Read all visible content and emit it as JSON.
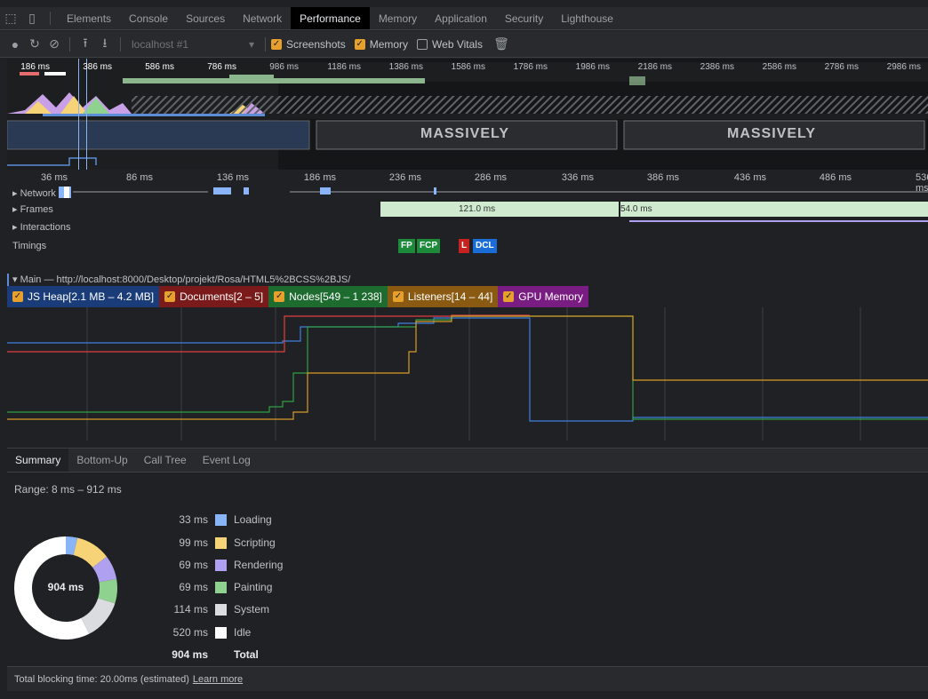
{
  "tabbar": {
    "tabs": [
      "Elements",
      "Console",
      "Sources",
      "Network",
      "Performance",
      "Memory",
      "Application",
      "Security",
      "Lighthouse"
    ],
    "active": "Performance"
  },
  "toolbar": {
    "profile_select": "localhost #1",
    "screenshots_label": "Screenshots",
    "memory_label": "Memory",
    "webvitals_label": "Web Vitals"
  },
  "overview": {
    "ticks": [
      "186 ms",
      "386 ms",
      "586 ms",
      "786 ms",
      "986 ms",
      "1186 ms",
      "1386 ms",
      "1586 ms",
      "1786 ms",
      "1986 ms",
      "2186 ms",
      "2386 ms",
      "2586 ms",
      "2786 ms",
      "2986 ms"
    ],
    "filmstrip_text": "MASSIVELY"
  },
  "timeline": {
    "ticks": [
      "36 ms",
      "86 ms",
      "136 ms",
      "186 ms",
      "236 ms",
      "286 ms",
      "336 ms",
      "386 ms",
      "436 ms",
      "486 ms",
      "536 ms"
    ]
  },
  "tracks": {
    "network": "Network",
    "frames": "Frames",
    "interactions": "Interactions",
    "timings": "Timings",
    "frame1": "121.0 ms",
    "frame2": "54.0 ms",
    "fp": "FP",
    "fcp": "FCP",
    "l": "L",
    "dcl": "DCL"
  },
  "main_track": "Main — http://localhost:8000/Desktop/projekt/Rosa/HTML5%2BCSS%2BJS/",
  "counters": [
    {
      "label": "JS Heap[2.1 MB – 4.2 MB]",
      "color": "#1a3d7a"
    },
    {
      "label": "Documents[2 – 5]",
      "color": "#7a1a1a"
    },
    {
      "label": "Nodes[549 – 1 238]",
      "color": "#1d6b2e"
    },
    {
      "label": "Listeners[14 – 44]",
      "color": "#8a5a12"
    },
    {
      "label": "GPU Memory",
      "color": "#7a1d82"
    }
  ],
  "bottom_tabs": [
    "Summary",
    "Bottom-Up",
    "Call Tree",
    "Event Log"
  ],
  "summary": {
    "range": "Range: 8 ms – 912 ms",
    "center": "904 ms",
    "rows": [
      {
        "value": "33 ms",
        "label": "Loading",
        "color": "#8ab4f8",
        "ms": 33
      },
      {
        "value": "99 ms",
        "label": "Scripting",
        "color": "#f5d376",
        "ms": 99
      },
      {
        "value": "69 ms",
        "label": "Rendering",
        "color": "#b0a0f0",
        "ms": 69
      },
      {
        "value": "69 ms",
        "label": "Painting",
        "color": "#8fd18f",
        "ms": 69
      },
      {
        "value": "114 ms",
        "label": "System",
        "color": "#dadce0",
        "ms": 114
      },
      {
        "value": "520 ms",
        "label": "Idle",
        "color": "#ffffff",
        "ms": 520
      }
    ],
    "total_value": "904 ms",
    "total_label": "Total"
  },
  "footer": {
    "text": "Total blocking time: 20.00ms (estimated)",
    "link": "Learn more"
  }
}
